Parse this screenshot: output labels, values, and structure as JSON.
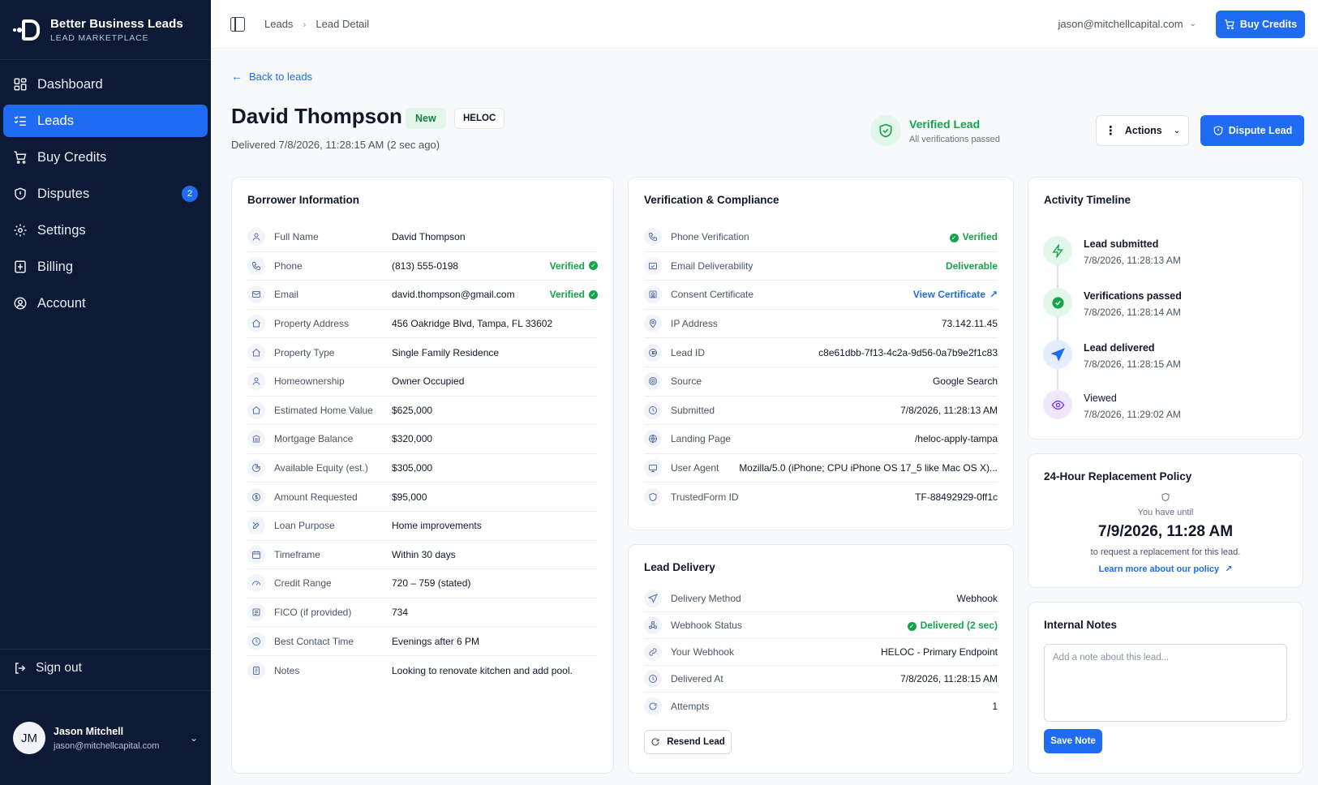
{
  "brand": {
    "name": "Better Business Leads",
    "subtitle": "LEAD MARKETPLACE"
  },
  "nav": [
    {
      "label": "Dashboard",
      "icon": "grid-icon",
      "active": false
    },
    {
      "label": "Leads",
      "icon": "list-check-icon",
      "active": true
    },
    {
      "label": "Buy Credits",
      "icon": "cart-icon",
      "active": false
    },
    {
      "label": "Disputes",
      "icon": "shield-icon",
      "active": false,
      "badge": "2"
    },
    {
      "label": "Settings",
      "icon": "gear-icon",
      "active": false
    },
    {
      "label": "Billing",
      "icon": "receipt-icon",
      "active": false
    },
    {
      "label": "Account",
      "icon": "user-circle-icon",
      "active": false
    }
  ],
  "signout": "Sign out",
  "user": {
    "initials": "JM",
    "name": "Jason Mitchell",
    "email": "jason@mitchellcapital.com"
  },
  "topbar": {
    "crumb1": "Leads",
    "crumb2": "Lead Detail",
    "email": "jason@mitchellcapital.com",
    "buy": "Buy Credits"
  },
  "header": {
    "back": "Back to leads",
    "name": "David Thompson",
    "status": "New",
    "product": "HELOC",
    "delivered": "Delivered 7/8/2026, 11:28:15 AM (2 sec ago)",
    "verified_title": "Verified Lead",
    "verified_sub": "All verifications passed",
    "actions": "Actions",
    "dispute": "Dispute Lead"
  },
  "borrower": {
    "title": "Borrower Information",
    "rows": [
      {
        "label": "Full Name",
        "value": "David Thompson",
        "icon": "user-icon"
      },
      {
        "label": "Phone",
        "value": "(813) 555-0198",
        "status": "Verified",
        "icon": "phone-icon"
      },
      {
        "label": "Email",
        "value": "david.thompson@gmail.com",
        "status": "Verified",
        "icon": "mail-icon"
      },
      {
        "label": "Property Address",
        "value": "456 Oakridge Blvd, Tampa, FL 33602",
        "icon": "home-icon"
      },
      {
        "label": "Property Type",
        "value": "Single Family Residence",
        "icon": "home-icon"
      },
      {
        "label": "Homeownership",
        "value": "Owner Occupied",
        "icon": "user-icon"
      },
      {
        "label": "Estimated Home Value",
        "value": "$625,000",
        "icon": "home-icon"
      },
      {
        "label": "Mortgage Balance",
        "value": "$320,000",
        "icon": "bank-icon"
      },
      {
        "label": "Available Equity (est.)",
        "value": "$305,000",
        "icon": "pie-icon"
      },
      {
        "label": "Amount Requested",
        "value": "$95,000",
        "icon": "dollar-icon"
      },
      {
        "label": "Loan Purpose",
        "value": "Home improvements",
        "icon": "tools-icon"
      },
      {
        "label": "Timeframe",
        "value": "Within 30 days",
        "icon": "calendar-icon"
      },
      {
        "label": "Credit Range",
        "value": "720 – 759 (stated)",
        "icon": "gauge-icon"
      },
      {
        "label": "FICO (if provided)",
        "value": "734",
        "icon": "score-icon"
      },
      {
        "label": "Best Contact Time",
        "value": "Evenings after 6 PM",
        "icon": "clock-icon"
      },
      {
        "label": "Notes",
        "value": "Looking to renovate kitchen and add pool.",
        "icon": "note-icon"
      }
    ]
  },
  "verification": {
    "title": "Verification & Compliance",
    "rows": [
      {
        "label": "Phone Verification",
        "value": "Verified",
        "style": "green-check",
        "icon": "phone-icon"
      },
      {
        "label": "Email Deliverability",
        "value": "Deliverable",
        "style": "green",
        "icon": "mail-check-icon"
      },
      {
        "label": "Consent Certificate",
        "value": "View Certificate",
        "style": "link",
        "icon": "certificate-icon"
      },
      {
        "label": "IP Address",
        "value": "73.142.11.45",
        "icon": "location-icon"
      },
      {
        "label": "Lead ID",
        "value": "c8e61dbb-7f13-4c2a-9d56-0a7b9e2f1c83",
        "icon": "id-icon"
      },
      {
        "label": "Source",
        "value": "Google Search",
        "icon": "target-icon"
      },
      {
        "label": "Submitted",
        "value": "7/8/2026, 11:28:13 AM",
        "icon": "clock-icon"
      },
      {
        "label": "Landing Page",
        "value": "/heloc-apply-tampa",
        "icon": "globe-icon"
      },
      {
        "label": "User Agent",
        "value": "Mozilla/5.0 (iPhone; CPU iPhone OS 17_5 like Mac OS X)...",
        "icon": "device-icon"
      },
      {
        "label": "TrustedForm ID",
        "value": "TF-88492929-0ff1c",
        "icon": "shield-icon"
      }
    ]
  },
  "delivery": {
    "title": "Lead Delivery",
    "rows": [
      {
        "label": "Delivery Method",
        "value": "Webhook",
        "icon": "send-icon"
      },
      {
        "label": "Webhook Status",
        "value": "Delivered (2 sec)",
        "style": "green-check",
        "icon": "webhook-icon"
      },
      {
        "label": "Your Webhook",
        "value": "HELOC - Primary Endpoint",
        "icon": "link-icon"
      },
      {
        "label": "Delivered At",
        "value": "7/8/2026, 11:28:15 AM",
        "icon": "clock-icon"
      },
      {
        "label": "Attempts",
        "value": "1",
        "icon": "refresh-icon"
      }
    ],
    "resend": "Resend Lead"
  },
  "timeline": {
    "title": "Activity Timeline",
    "items": [
      {
        "title": "Lead submitted",
        "time": "7/8/2026, 11:28:13 AM",
        "icon": "bolt-icon",
        "color": "#16a34a",
        "bg": "#e3f6ea"
      },
      {
        "title": "Verifications passed",
        "time": "7/8/2026, 11:28:14 AM",
        "icon": "check-circle-icon",
        "color": "#16a34a",
        "bg": "#e3f6ea"
      },
      {
        "title": "Lead delivered",
        "time": "7/8/2026, 11:28:15 AM",
        "icon": "paper-plane-icon",
        "color": "#1f6bf2",
        "bg": "#e3edfd"
      },
      {
        "title": "Viewed",
        "time": "7/8/2026, 11:29:02 AM",
        "icon": "eye-icon",
        "color": "#7c3aed",
        "bg": "#efe8fd"
      }
    ]
  },
  "policy": {
    "title": "24-Hour Replacement Policy",
    "until": "You have until",
    "date": "7/9/2026, 11:28 AM",
    "desc": "to request a replacement for this lead.",
    "link": "Learn more about our policy"
  },
  "notes": {
    "title": "Internal Notes",
    "placeholder": "Add a note about this lead...",
    "save": "Save Note"
  },
  "colors": {
    "sidebar": "#0c1a36",
    "primary": "#1f6bf2",
    "success": "#16a34a"
  }
}
